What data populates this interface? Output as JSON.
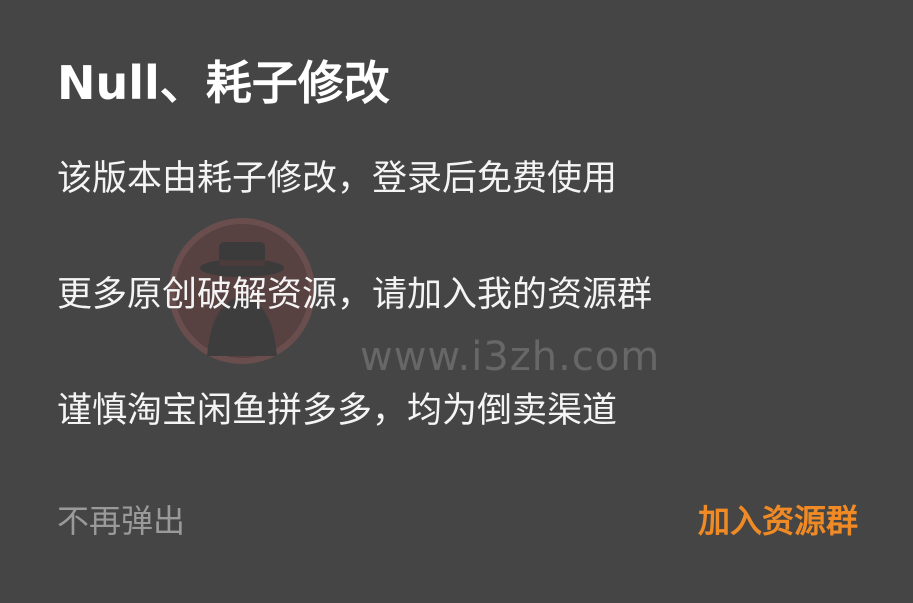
{
  "dialog": {
    "title": "Null、耗子修改",
    "messages": [
      "该版本由耗子修改，登录后免费使用",
      "更多原创破解资源，请加入我的资源群",
      "谨慎淘宝闲鱼拼多多，均为倒卖渠道"
    ],
    "watermark": "www.i3zh.com",
    "dismiss_label": "不再弹出",
    "join_label": "加入资源群"
  },
  "colors": {
    "background": "#454545",
    "text": "#ffffff",
    "dismiss": "#9a9a9a",
    "accent": "#f08a24"
  }
}
